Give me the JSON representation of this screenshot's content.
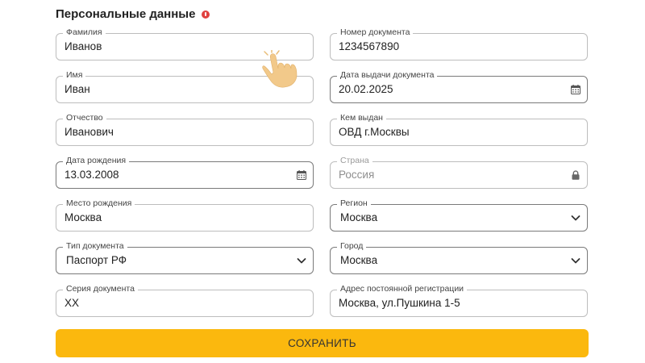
{
  "section": {
    "title": "Персональные данные"
  },
  "left": [
    {
      "label": "Фамилия",
      "value": "Иванов"
    },
    {
      "label": "Имя",
      "value": "Иван"
    },
    {
      "label": "Отчество",
      "value": "Иванович"
    },
    {
      "label": "Дата рождения",
      "value": "13.03.2008",
      "icon": "calendar-icon"
    },
    {
      "label": "Место рождения",
      "value": "Москва"
    },
    {
      "label": "Тип документа",
      "value": "Паспорт РФ",
      "icon": "chevron-down-icon"
    },
    {
      "label": "Серия документа",
      "value": "ХХ"
    }
  ],
  "right": [
    {
      "label": "Номер документа",
      "value": "1234567890"
    },
    {
      "label": "Дата выдачи документа",
      "value": "20.02.2025",
      "icon": "calendar-icon"
    },
    {
      "label": "Кем выдан",
      "value": "ОВД г.Москвы"
    },
    {
      "label": "Страна",
      "value": "Россия",
      "icon": "lock-icon",
      "disabled": true
    },
    {
      "label": "Регион",
      "value": "Москва",
      "icon": "chevron-down-icon"
    },
    {
      "label": "Город",
      "value": "Москва",
      "icon": "chevron-down-icon"
    },
    {
      "label": "Адрес постоянной регистрации",
      "value": "Москва, ул.Пушкина 1-5"
    }
  ],
  "save_button": {
    "label": "СОХРАНИТЬ"
  },
  "colors": {
    "accent": "#fbb80e",
    "required": "#e0413f",
    "border": "#bdbdbd"
  },
  "cursor": {
    "icon": "pointing-hand-icon"
  }
}
